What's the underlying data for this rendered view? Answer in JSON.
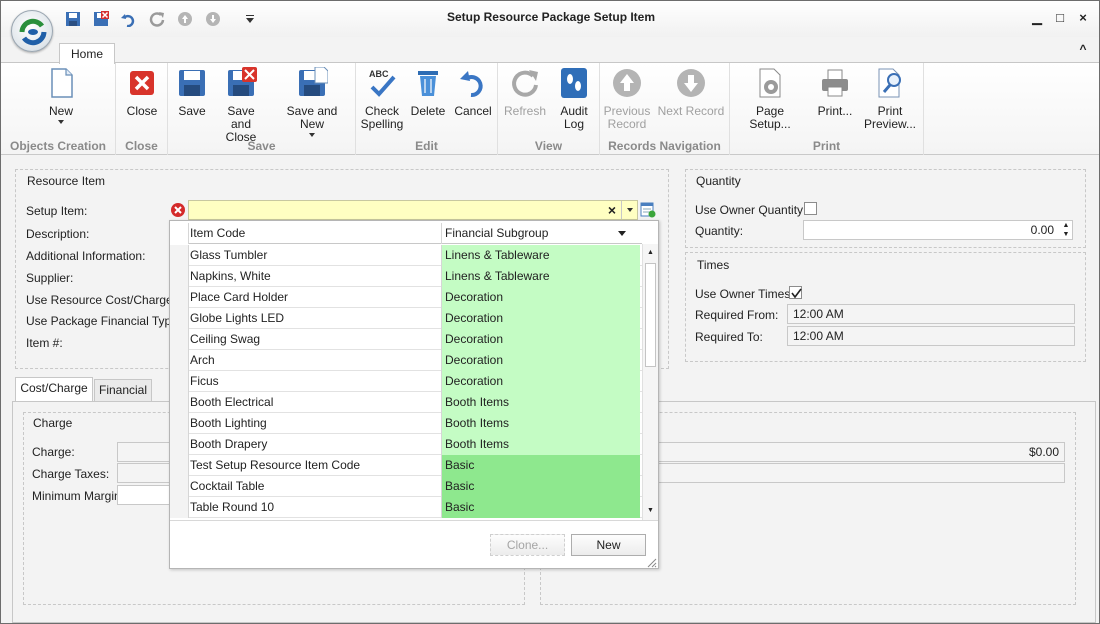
{
  "window": {
    "title": "Setup Resource Package Setup Item",
    "controls": {
      "minimize": "▁",
      "maximize": "□",
      "close": "×",
      "collapse": "^"
    }
  },
  "ribbon": {
    "tab": "Home",
    "groups": {
      "objects_creation": {
        "label": "Objects Creation",
        "new": "New"
      },
      "close": {
        "label": "Close",
        "close": "Close"
      },
      "save": {
        "label": "Save",
        "save": "Save",
        "save_close_1": "Save and",
        "save_close_2": "Close",
        "save_new": "Save and New"
      },
      "edit": {
        "label": "Edit",
        "check_1": "Check",
        "check_2": "Spelling",
        "delete": "Delete",
        "cancel": "Cancel"
      },
      "view": {
        "label": "View",
        "refresh": "Refresh",
        "audit_1": "Audit",
        "audit_2": "Log"
      },
      "nav": {
        "label": "Records Navigation",
        "prev_1": "Previous",
        "prev_2": "Record",
        "next": "Next Record"
      },
      "print": {
        "label": "Print",
        "page_setup": "Page Setup...",
        "print": "Print...",
        "preview_1": "Print",
        "preview_2": "Preview..."
      }
    }
  },
  "resource_item": {
    "title": "Resource Item",
    "labels": [
      "Setup Item:",
      "Description:",
      "Additional Information:",
      "Supplier:",
      "Use Resource Cost/Charge:",
      "Use Package Financial Type:",
      "Item #:"
    ]
  },
  "quantity": {
    "title": "Quantity",
    "use_owner": "Use Owner Quantity:",
    "qty_label": "Quantity:",
    "qty_value": "0.00"
  },
  "times": {
    "title": "Times",
    "use_owner": "Use Owner Times:",
    "from_label": "Required From:",
    "from_value": "12:00 AM",
    "to_label": "Required To:",
    "to_value": "12:00 AM"
  },
  "tabs": [
    "Cost/Charge",
    "Financial"
  ],
  "charge": {
    "title": "Charge",
    "charge": "Charge:",
    "taxes": "Charge Taxes:",
    "margin": "Minimum Margin:",
    "total": "$0.00"
  },
  "dropdown": {
    "col1": "Item Code",
    "col2": "Financial Subgroup",
    "rows": [
      {
        "code": "Glass Tumbler",
        "group": "Linens & Tableware"
      },
      {
        "code": "Napkins, White",
        "group": "Linens & Tableware"
      },
      {
        "code": "Place Card Holder",
        "group": "Decoration"
      },
      {
        "code": "Globe Lights LED",
        "group": "Decoration"
      },
      {
        "code": "Ceiling Swag",
        "group": "Decoration"
      },
      {
        "code": "Arch",
        "group": "Decoration"
      },
      {
        "code": "Ficus",
        "group": "Decoration"
      },
      {
        "code": "Booth Electrical",
        "group": "Booth Items"
      },
      {
        "code": "Booth Lighting",
        "group": "Booth Items"
      },
      {
        "code": "Booth Drapery",
        "group": "Booth Items"
      },
      {
        "code": "Test Setup Resource Item Code",
        "group": "Basic"
      },
      {
        "code": "Cocktail Table",
        "group": "Basic"
      },
      {
        "code": "Table Round 10",
        "group": "Basic"
      }
    ],
    "clone": "Clone...",
    "new": "New"
  },
  "colors": {
    "light_green": "#c4fcc4",
    "green": "#8ee88e",
    "input_yellow": "#ffffc2"
  }
}
